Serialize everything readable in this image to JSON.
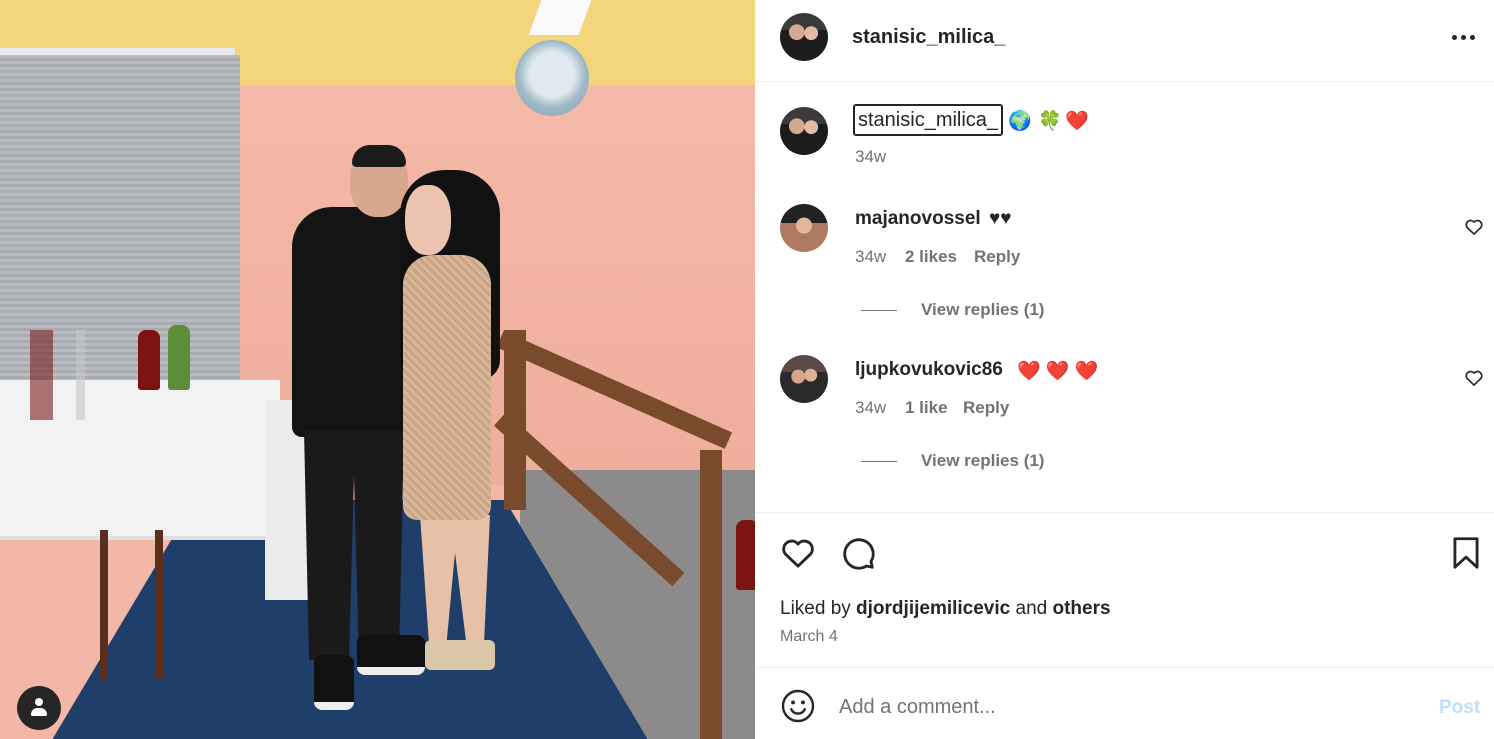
{
  "photo": {
    "account_icon": "person-icon"
  },
  "header": {
    "username": "stanisic_milica_",
    "more_icon": "more-horizontal-icon"
  },
  "caption": {
    "username": "stanisic_milica_",
    "emojis": [
      "🌍",
      "🍀",
      "❤️"
    ],
    "time": "34w"
  },
  "comments": [
    {
      "username": "majanovossel",
      "text": "♥♥",
      "time": "34w",
      "likes": "2 likes",
      "reply_label": "Reply",
      "view_replies": "View replies (1)"
    },
    {
      "username": "ljupkovukovic86",
      "text": "❤️ ❤️ ❤️",
      "time": "34w",
      "likes": "1 like",
      "reply_label": "Reply",
      "view_replies": "View replies (1)"
    }
  ],
  "actions": {
    "like_icon": "heart-icon",
    "comment_icon": "comment-icon",
    "save_icon": "bookmark-icon",
    "liked_by_prefix": "Liked by ",
    "liked_by_user": "djordjijemilicevic",
    "liked_by_middle": " and ",
    "liked_by_others": "others",
    "date": "March 4"
  },
  "comment_box": {
    "emoji_icon": "smiley-icon",
    "placeholder": "Add a comment...",
    "post_label": "Post"
  },
  "colors": {
    "text": "#262626",
    "secondary": "#737373",
    "post_disabled": "#c0dffd",
    "divider": "#efefef"
  }
}
